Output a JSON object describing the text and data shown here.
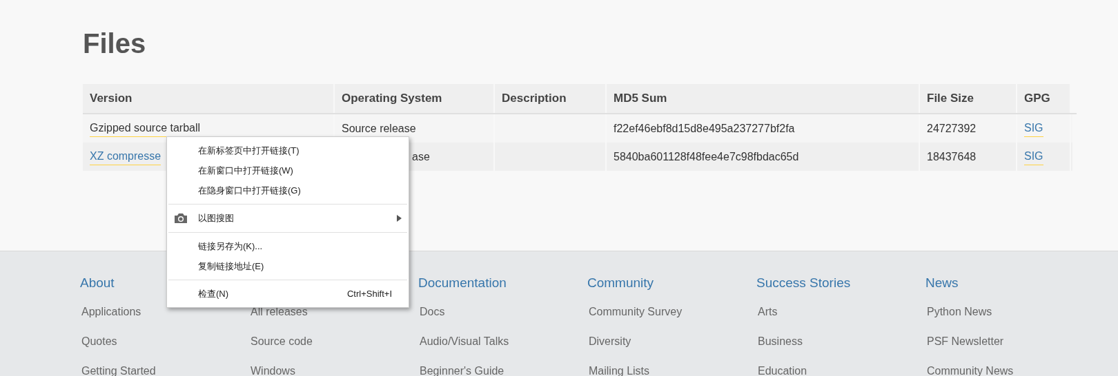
{
  "heading": "Files",
  "table": {
    "columns": [
      "Version",
      "Operating System",
      "Description",
      "MD5 Sum",
      "File Size",
      "GPG"
    ],
    "rows": [
      {
        "version": {
          "text": "Gzipped source tarball",
          "active": true
        },
        "os": "Source release",
        "md5": "f22ef46ebf8d15d8e495a237277bf2fa",
        "size": "24727392",
        "gpg": "SIG"
      },
      {
        "version": {
          "text": "XZ compresse",
          "active": false
        },
        "os": "ase",
        "md5": "5840ba601128f48fee4e7c98fbdac65d",
        "size": "18437648",
        "gpg": "SIG"
      }
    ]
  },
  "context_menu": [
    {
      "kind": "item",
      "label": "在新标签页中打开链接(T)"
    },
    {
      "kind": "item",
      "label": "在新窗口中打开链接(W)"
    },
    {
      "kind": "item",
      "label": "在隐身窗口中打开链接(G)"
    },
    {
      "kind": "separator"
    },
    {
      "kind": "submenu",
      "label": "以图搜图"
    },
    {
      "kind": "separator"
    },
    {
      "kind": "item",
      "label": "链接另存为(K)..."
    },
    {
      "kind": "item",
      "label": "复制链接地址(E)"
    },
    {
      "kind": "separator"
    },
    {
      "kind": "item",
      "label": "检查(N)",
      "shortcut": "Ctrl+Shift+I"
    }
  ],
  "footer": [
    {
      "heading": "About",
      "links": [
        "Applications",
        "Quotes",
        "Getting Started"
      ]
    },
    {
      "links": [
        "All releases",
        "Source code",
        "Windows"
      ]
    },
    {
      "heading": "Documentation",
      "links": [
        "Docs",
        "Audio/Visual Talks",
        "Beginner's Guide"
      ]
    },
    {
      "heading": "Community",
      "links": [
        "Community Survey",
        "Diversity",
        "Mailing Lists"
      ]
    },
    {
      "heading": "Success Stories",
      "links": [
        "Arts",
        "Business",
        "Education"
      ]
    },
    {
      "heading": "News",
      "links": [
        "Python News",
        "PSF Newsletter",
        "Community News"
      ]
    }
  ]
}
